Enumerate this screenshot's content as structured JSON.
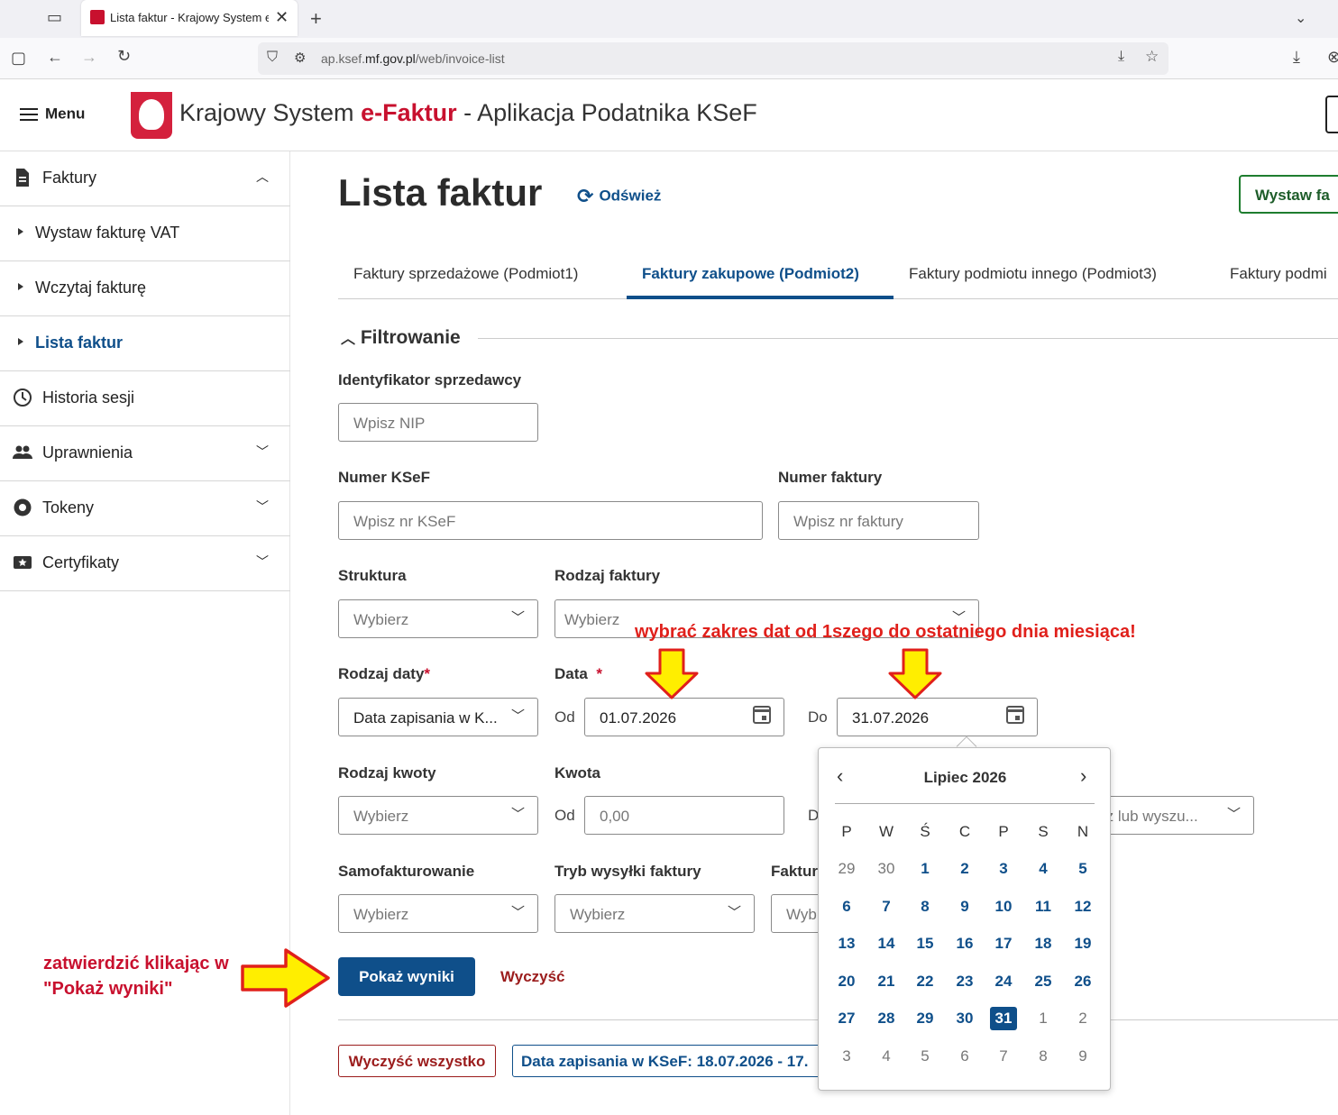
{
  "browser": {
    "tab_title": "Lista faktur - Krajowy System e-Fakt",
    "url_prefix": "ap.ksef.",
    "url_domain": "mf.gov.pl",
    "url_path": "/web/invoice-list"
  },
  "header": {
    "menu_label": "Menu",
    "title_part1": "Krajowy System ",
    "title_brand": "e-Faktur",
    "title_part2": " - Aplikacja Podatnika KSeF"
  },
  "sidebar": {
    "items": [
      {
        "label": "Faktury"
      },
      {
        "label": "Wystaw fakturę VAT"
      },
      {
        "label": "Wczytaj fakturę"
      },
      {
        "label": "Lista faktur"
      },
      {
        "label": "Historia sesji"
      },
      {
        "label": "Uprawnienia"
      },
      {
        "label": "Tokeny"
      },
      {
        "label": "Certyfikaty"
      }
    ]
  },
  "main": {
    "page_title": "Lista faktur",
    "refresh_label": "Odśwież",
    "issue_button": "Wystaw fa",
    "tabs": [
      {
        "label": "Faktury sprzedażowe (Podmiot1)"
      },
      {
        "label": "Faktury zakupowe (Podmiot2)"
      },
      {
        "label": "Faktury podmiotu innego (Podmiot3)"
      },
      {
        "label": "Faktury podmi"
      }
    ],
    "filter_heading": "Filtrowanie"
  },
  "filters": {
    "seller_id": {
      "label": "Identyfikator sprzedawcy",
      "placeholder": "Wpisz NIP"
    },
    "ksef_number": {
      "label": "Numer KSeF",
      "placeholder": "Wpisz nr KSeF"
    },
    "invoice_number": {
      "label": "Numer faktury",
      "placeholder": "Wpisz nr faktury"
    },
    "structure": {
      "label": "Struktura",
      "value": "Wybierz"
    },
    "invoice_type": {
      "label": "Rodzaj faktury",
      "value": "Wybierz"
    },
    "date_type": {
      "label": "Rodzaj daty",
      "required": "*",
      "value": "Data zapisania w K..."
    },
    "date": {
      "label": "Data",
      "required": "*",
      "from_label": "Od",
      "from_value": "01.07.2026",
      "to_label": "Do",
      "to_value": "31.07.2026"
    },
    "amount_type": {
      "label": "Rodzaj kwoty",
      "value": "Wybierz"
    },
    "amount": {
      "label": "Kwota",
      "from_label": "Od",
      "from_placeholder": "0,00",
      "to_label_fragment": "D"
    },
    "currency_fragment": {
      "value": "rz lub wyszu..."
    },
    "self_invoicing": {
      "label": "Samofakturowanie",
      "value": "Wybierz"
    },
    "send_mode": {
      "label": "Tryb wysyłki faktury",
      "value": "Wybierz"
    },
    "third": {
      "label_fragment": "Faktur",
      "value_fragment": "Wyb"
    }
  },
  "actions": {
    "show_results": "Pokaż wyniki",
    "clear": "Wyczyść",
    "clear_all": "Wyczyść wszystko",
    "active_filter_chip": "Data zapisania w KSeF: 18.07.2026 - 17."
  },
  "calendar": {
    "month_title": "Lipiec 2026",
    "weekdays": [
      "P",
      "W",
      "Ś",
      "C",
      "P",
      "S",
      "N"
    ],
    "weeks": [
      [
        "29",
        "30",
        "1",
        "2",
        "3",
        "4",
        "5"
      ],
      [
        "6",
        "7",
        "8",
        "9",
        "10",
        "11",
        "12"
      ],
      [
        "13",
        "14",
        "15",
        "16",
        "17",
        "18",
        "19"
      ],
      [
        "20",
        "21",
        "22",
        "23",
        "24",
        "25",
        "26"
      ],
      [
        "27",
        "28",
        "29",
        "30",
        "31",
        "1",
        "2"
      ],
      [
        "3",
        "4",
        "5",
        "6",
        "7",
        "8",
        "9"
      ]
    ],
    "selected_day": "31"
  },
  "annotations": {
    "date_hint": "wybrać zakres dat od 1szego do ostatniego dnia miesiąca!",
    "confirm_hint_line1": "zatwierdzić klikając w",
    "confirm_hint_line2": "\"Pokaż wyniki\"",
    "arrow_color": "#ffee00",
    "arrow_outline": "#e0201b"
  },
  "colors": {
    "primary": "#0f4f8a",
    "danger": "#9b1c1c",
    "brand_red": "#c8102e",
    "issue_green": "#1e7d2f"
  }
}
